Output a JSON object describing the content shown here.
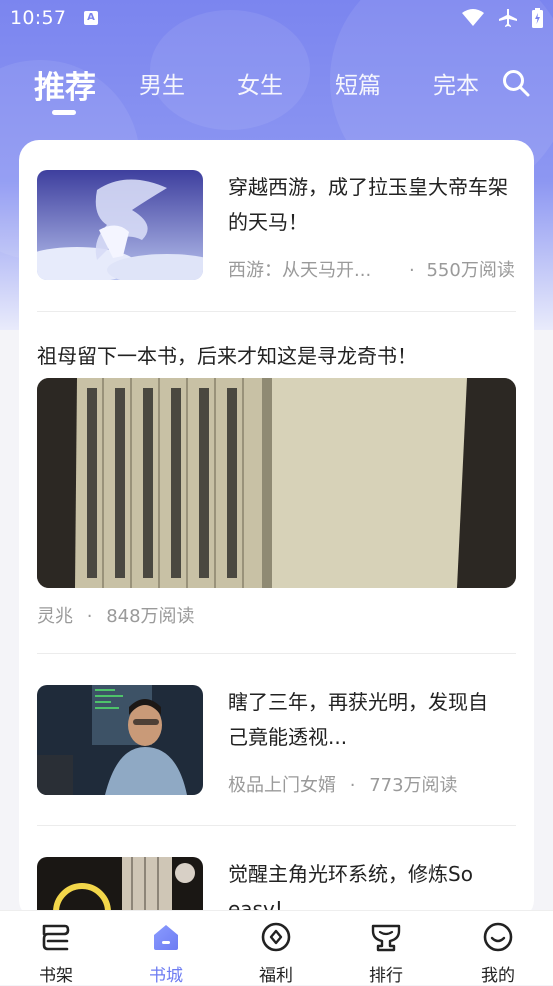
{
  "status_bar": {
    "time": "10:57",
    "badge": "A"
  },
  "tabs": [
    {
      "label": "推荐",
      "active": true
    },
    {
      "label": "男生",
      "active": false
    },
    {
      "label": "女生",
      "active": false
    },
    {
      "label": "短篇",
      "active": false
    },
    {
      "label": "完本",
      "active": false
    }
  ],
  "colors": {
    "accent": "#6d7cf2",
    "header": "#7b85ef"
  },
  "feed": [
    {
      "title": "穿越西游，成了拉玉皇大帝车架的天马！",
      "source": "西游：从天马开...",
      "reads": "550万阅读",
      "image": "pegasus-clouds"
    },
    {
      "title": "祖母留下一本书，后来才知这是寻龙奇书！",
      "source": "灵兆",
      "reads": "848万阅读",
      "image": "ancient-book"
    },
    {
      "title_line1": "瞎了三年，再获光明，发现自",
      "title_line2": "己竟能透视...",
      "source": "极品上门女婿",
      "reads": "773万阅读",
      "image": "man-at-computer"
    },
    {
      "title_line1": "觉醒主角光环系统，修炼So",
      "title_line2": "easy!",
      "image": "glowing-ring"
    }
  ],
  "bottom_nav": [
    {
      "label": "书架",
      "icon": "bookshelf-icon",
      "active": false
    },
    {
      "label": "书城",
      "icon": "home-icon",
      "active": true
    },
    {
      "label": "福利",
      "icon": "gift-coin-icon",
      "active": false
    },
    {
      "label": "排行",
      "icon": "trophy-icon",
      "active": false
    },
    {
      "label": "我的",
      "icon": "smile-icon",
      "active": false
    }
  ]
}
